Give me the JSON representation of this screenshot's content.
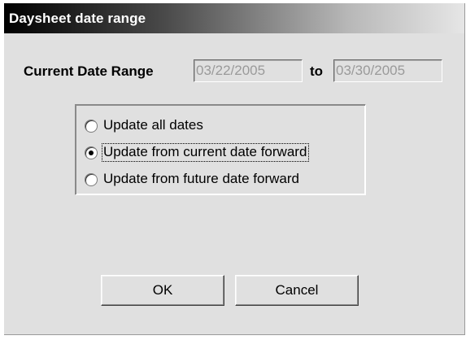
{
  "dialog": {
    "title": "Daysheet date range"
  },
  "date_range": {
    "label": "Current Date Range",
    "from_value": "03/22/2005",
    "to_label": "to",
    "to_value": "03/30/2005"
  },
  "update_options": [
    {
      "label": "Update all dates",
      "selected": false
    },
    {
      "label": "Update from current date forward",
      "selected": true
    },
    {
      "label": "Update from future date forward",
      "selected": false
    }
  ],
  "buttons": {
    "ok_label": "OK",
    "cancel_label": "Cancel"
  }
}
